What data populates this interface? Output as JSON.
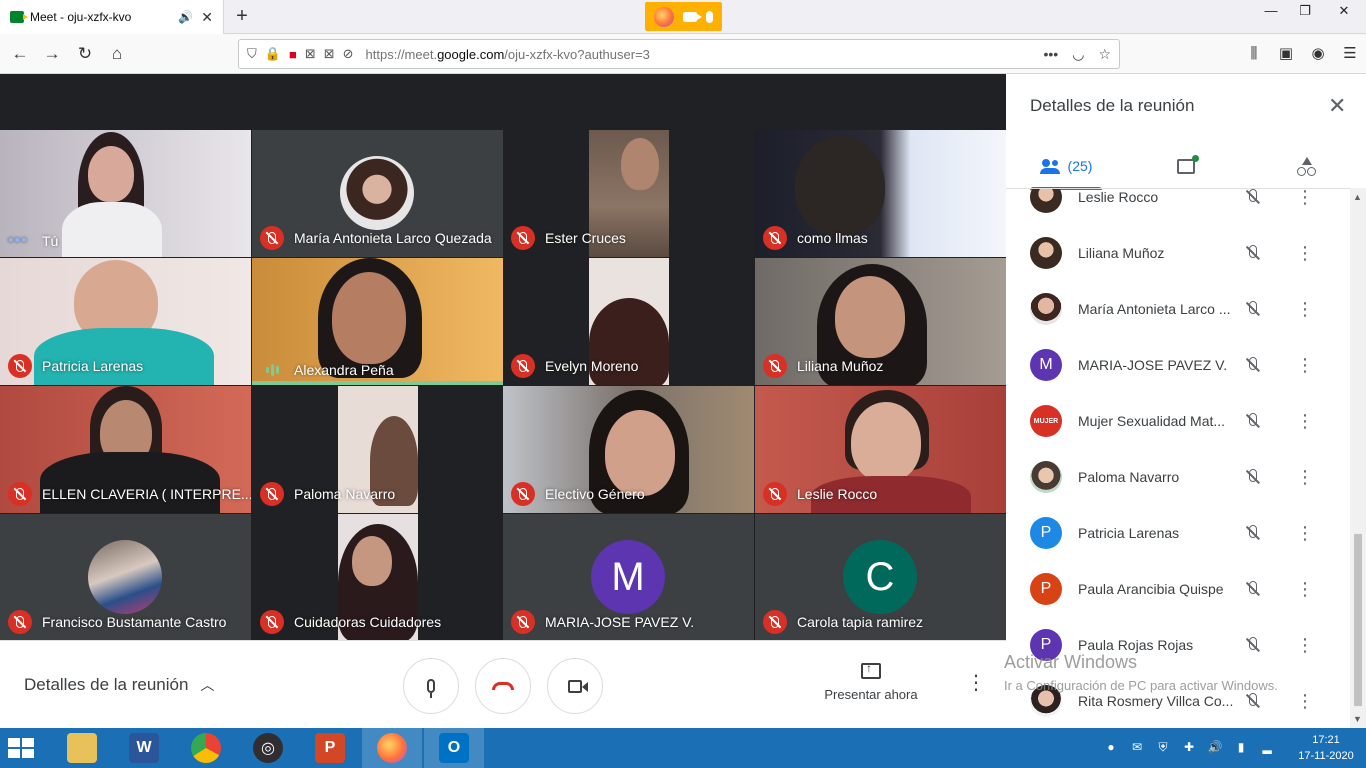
{
  "browser": {
    "tab_title": "Meet - oju-xzfx-kvo",
    "new_tab": "+",
    "url_prefix": "https://meet.",
    "url_domain": "google.com",
    "url_path": "/oju-xzfx-kvo?authuser=3",
    "page_actions": "•••"
  },
  "meet": {
    "tiles": [
      {
        "name": "Tú",
        "status": "self"
      },
      {
        "name": "María Antonieta Larco Quezada",
        "status": "muted"
      },
      {
        "name": "Ester Cruces",
        "status": "muted"
      },
      {
        "name": "como llmas",
        "status": "muted"
      },
      {
        "name": "Patricia Larenas",
        "status": "muted"
      },
      {
        "name": "Alexandra Peña",
        "status": "speaking"
      },
      {
        "name": "Evelyn Moreno",
        "status": "muted"
      },
      {
        "name": "Liliana Muñoz",
        "status": "muted"
      },
      {
        "name": "ELLEN CLAVERIA ( INTERPRE...",
        "status": "muted"
      },
      {
        "name": "Paloma Navarro",
        "status": "muted"
      },
      {
        "name": "Electivo Género",
        "status": "muted"
      },
      {
        "name": "Leslie Rocco",
        "status": "muted"
      },
      {
        "name": "Francisco Bustamante Castro",
        "status": "muted"
      },
      {
        "name": "Cuidadoras Cuidadores",
        "status": "muted"
      },
      {
        "name": "MARIA-JOSE PAVEZ V.",
        "status": "muted",
        "initial": "M"
      },
      {
        "name": "Carola tapia ramirez",
        "status": "muted",
        "initial": "C"
      }
    ],
    "bottom": {
      "meeting_details": "Detalles de la reunión",
      "present_now": "Presentar ahora"
    }
  },
  "panel": {
    "title": "Detalles de la reunión",
    "people_count": "(25)",
    "participants": [
      {
        "name": "Leslie Rocco",
        "avatar": "photo"
      },
      {
        "name": "Liliana Muñoz",
        "avatar": "photo"
      },
      {
        "name": "María Antonieta Larco ...",
        "avatar": "photo"
      },
      {
        "name": "MARIA-JOSE PAVEZ V.",
        "avatar": "M",
        "color": "#5e35b1"
      },
      {
        "name": "Mujer Sexualidad Mat...",
        "avatar": "logo",
        "color": "#d93025"
      },
      {
        "name": "Paloma Navarro",
        "avatar": "photo"
      },
      {
        "name": "Patricia Larenas",
        "avatar": "P",
        "color": "#1e88e5"
      },
      {
        "name": "Paula Arancibia Quispe",
        "avatar": "P",
        "color": "#d84315"
      },
      {
        "name": "Paula Rojas Rojas",
        "avatar": "P",
        "color": "#5e35b1"
      },
      {
        "name": "Rita Rosmery Villca Co...",
        "avatar": "photo"
      }
    ],
    "logo_text": "MUJER"
  },
  "watermark": {
    "line1": "Activar Windows",
    "line2": "Ir a Configuración de PC para activar Windows."
  },
  "taskbar": {
    "time": "17:21",
    "date": "17-11-2020"
  },
  "colors": {
    "muted_red": "#d93025",
    "speaking_green": "#81c995",
    "accent_blue": "#1a73e8",
    "taskbar_blue": "#1a6fb5"
  }
}
